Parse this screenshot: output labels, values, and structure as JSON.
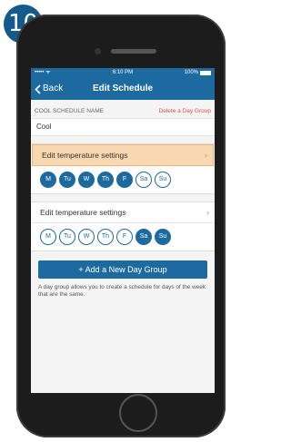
{
  "step": {
    "number": "10"
  },
  "status_bar": {
    "carrier": "••••• ᯤ",
    "time": "6:10 PM",
    "battery": "100%"
  },
  "nav": {
    "back_label": "Back",
    "title": "Edit Schedule"
  },
  "section": {
    "label": "COOL SCHEDULE NAME",
    "delete_label": "Delete a Day Group"
  },
  "schedule": {
    "name": "Cool"
  },
  "day_groups": [
    {
      "label": "Edit temperature settings",
      "highlighted": true,
      "days": [
        {
          "label": "M",
          "selected": true
        },
        {
          "label": "Tu",
          "selected": true
        },
        {
          "label": "W",
          "selected": true
        },
        {
          "label": "Th",
          "selected": true
        },
        {
          "label": "F",
          "selected": true
        },
        {
          "label": "Sa",
          "selected": false
        },
        {
          "label": "Su",
          "selected": false
        }
      ]
    },
    {
      "label": "Edit temperature settings",
      "highlighted": false,
      "days": [
        {
          "label": "M",
          "selected": false
        },
        {
          "label": "Tu",
          "selected": false
        },
        {
          "label": "W",
          "selected": false
        },
        {
          "label": "Th",
          "selected": false
        },
        {
          "label": "F",
          "selected": false
        },
        {
          "label": "Sa",
          "selected": true
        },
        {
          "label": "Su",
          "selected": true
        }
      ]
    }
  ],
  "add_button": {
    "label": "+ Add a New Day Group"
  },
  "help": {
    "text": "A day group allows you to create a schedule for days of the week that are the same."
  },
  "colors": {
    "primary": "#1d6aa0",
    "highlight": "#f8d8b0",
    "delete": "#d9534f",
    "badge": "#145a8c"
  }
}
